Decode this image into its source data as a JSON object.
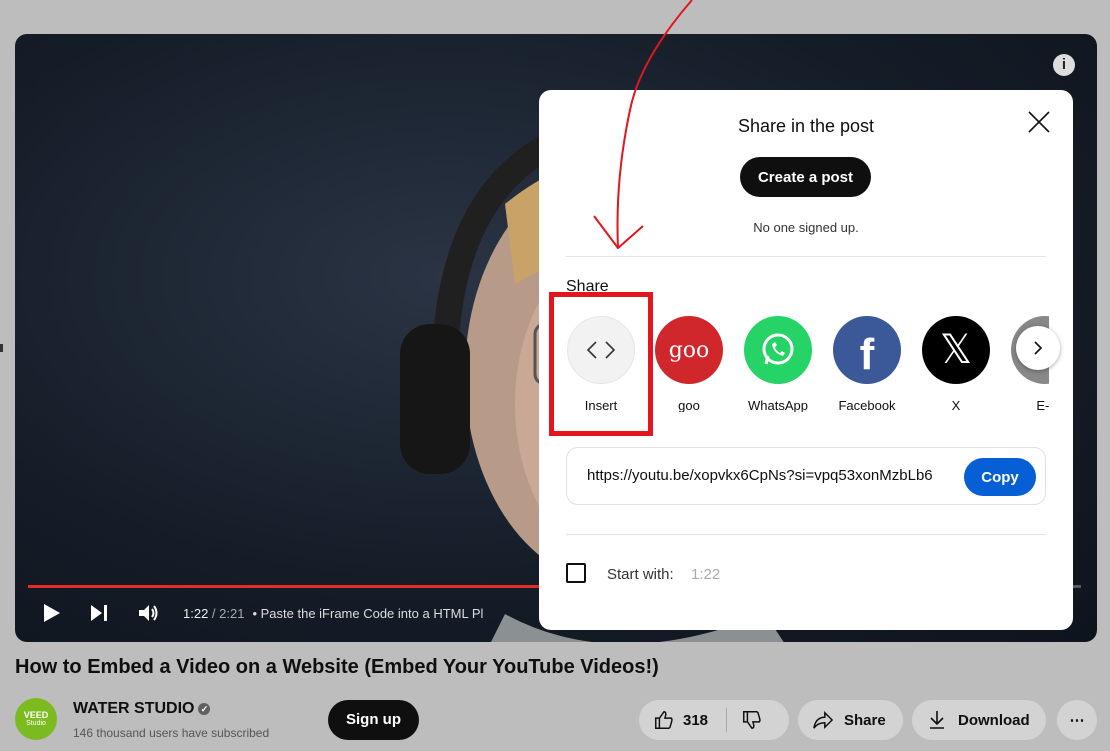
{
  "player": {
    "time_current": "1:22",
    "time_total": " / 2:21",
    "chapter": "• Paste the iFrame Code into a HTML Pl",
    "progress_fraction": 0.49
  },
  "video": {
    "title": "How to Embed a Video on a Website (Embed Your YouTube Videos!)"
  },
  "channel": {
    "avatar_text_top": "VEED",
    "avatar_text_bottom": "Studio",
    "name": "WATER STUDIO",
    "subscribers": "146 thousand users have subscribed",
    "signup_label": "Sign up"
  },
  "actions": {
    "likes": "318",
    "share_label": "Share",
    "download_label": "Download",
    "more_label": "⋯"
  },
  "modal": {
    "title": "Share in the post",
    "create_post_label": "Create a post",
    "no_one_text": "No one signed up.",
    "share_label": "Share",
    "targets": [
      {
        "label": "Insert",
        "icon": "code-icon",
        "color": "#f2f2f2"
      },
      {
        "label": "goo",
        "icon": "goo-icon",
        "glyph": "goo",
        "color": "#d0272c"
      },
      {
        "label": "WhatsApp",
        "icon": "whatsapp-icon",
        "color": "#25d366"
      },
      {
        "label": "Facebook",
        "icon": "facebook-icon",
        "glyph": "f",
        "color": "#3b5998"
      },
      {
        "label": "X",
        "icon": "x-logo-icon",
        "glyph": "𝕏",
        "color": "#000000"
      },
      {
        "label": "E-r",
        "icon": "email-icon",
        "color": "#888888"
      }
    ],
    "url": "https://youtu.be/xopvkx6CpNs?si=vpq53xonMzbLb6",
    "copy_label": "Copy",
    "start_with_label": "Start with:",
    "start_with_time": "1:22"
  },
  "colors": {
    "accent_red": "#e4151f",
    "copy_blue": "#065fd4",
    "progress_red": "#e52d27"
  }
}
